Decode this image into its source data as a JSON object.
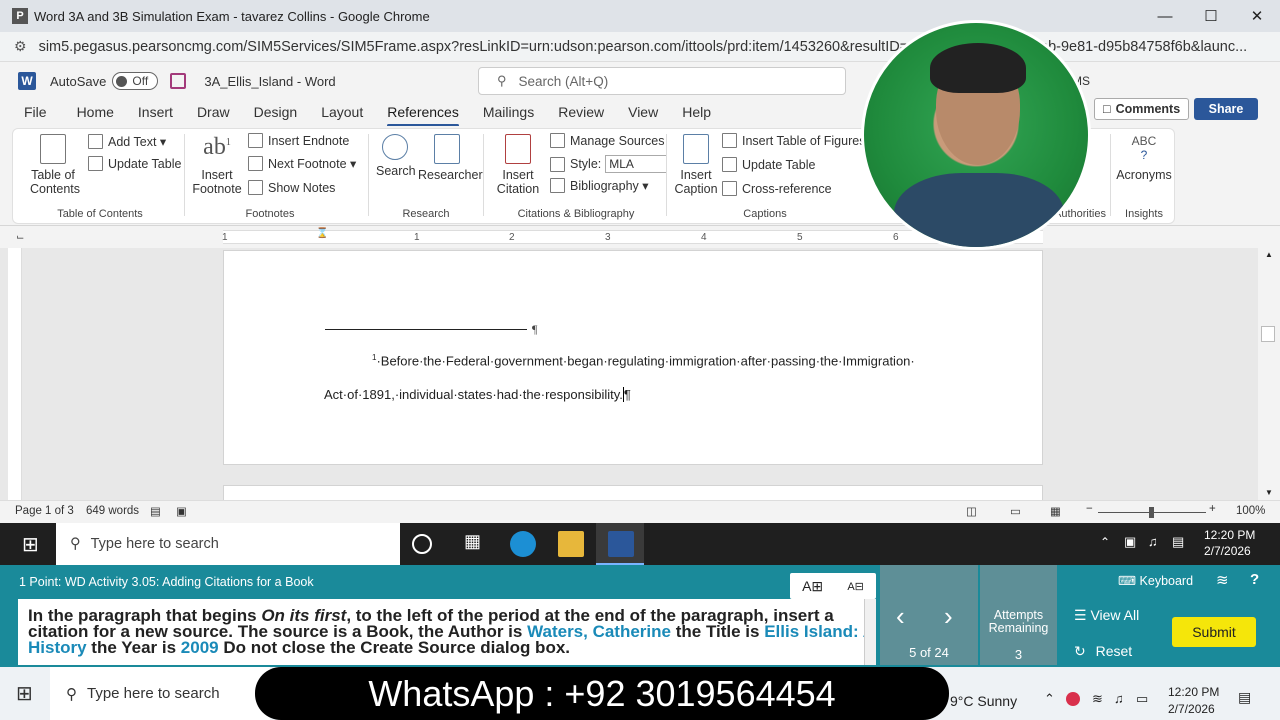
{
  "browser": {
    "favicon": "P",
    "title": "Word 3A and 3B Simulation Exam - tavarez Collins - Google Chrome",
    "url": "sim5.pegasus.pearsoncmg.com/SIM5Services/SIM5Frame.aspx?resLinkID=urn:udson:pearson.com/ittools/prd:item/1453260&resultID=&nor",
    "url_tail": "ab-9e81-d95b84758f6b&launc..."
  },
  "word": {
    "logo": "W",
    "autosave_label": "AutoSave",
    "autosave_state": "Off",
    "doc_title": "3A_Ellis_Island - Word",
    "search_placeholder": "Search (Alt+Q)",
    "user_initials": "MS",
    "comments_label": "Comments",
    "share_label": "Share",
    "tabs": [
      "File",
      "Home",
      "Insert",
      "Draw",
      "Design",
      "Layout",
      "References",
      "Mailings",
      "Review",
      "View",
      "Help"
    ],
    "active_tab": "References"
  },
  "ribbon": {
    "toc": {
      "btn": "Table of Contents",
      "add_text": "Add Text",
      "update_table": "Update Table",
      "group": "Table of Contents"
    },
    "footnotes": {
      "insert_footnote": "Insert Footnote",
      "insert_endnote": "Insert Endnote",
      "next_footnote": "Next Footnote",
      "show_notes": "Show Notes",
      "group": "Footnotes"
    },
    "research": {
      "search": "Search",
      "researcher": "Researcher",
      "group": "Research"
    },
    "citations": {
      "insert_citation": "Insert Citation",
      "manage_sources": "Manage Sources",
      "style_label": "Style:",
      "style_value": "MLA",
      "bibliography": "Bibliography",
      "group": "Citations & Bibliography"
    },
    "captions": {
      "insert_caption": "Insert Caption",
      "insert_tof": "Insert Table of Figures",
      "update_table": "Update Table",
      "cross_ref": "Cross-reference",
      "group": "Captions"
    },
    "authorities": {
      "group": "Authorities"
    },
    "insights": {
      "acronyms": "Acronyms",
      "group": "Insights",
      "abc": "ABC"
    }
  },
  "ruler": {
    "numbers": [
      "1",
      "1",
      "2",
      "3",
      "4",
      "5",
      "6"
    ]
  },
  "document": {
    "pilcrow": "¶",
    "footnote_num": "1",
    "footnote_line1": "·Before·the·Federal·government·began·regulating·immigration·after·passing·the·Immigration·",
    "footnote_line2": "Act·of·1891,·individual·states·had·the·responsibility.",
    "footnote_end": "¶"
  },
  "status": {
    "page": "Page 1 of 3",
    "words": "649 words",
    "zoom": "100%"
  },
  "taskbar": {
    "search": "Type here to search",
    "time": "12:20 PM",
    "date": "2/7/2026"
  },
  "task": {
    "header": "1 Point: WD Activity 3.05: Adding Citations for a Book",
    "instr_parts": [
      "In the paragraph that begins ",
      "On its first",
      ", to the left of the period at the end of the paragraph, insert a citation for a new source. The source is a Book, the Author is ",
      "Waters, Catherine",
      " the Title is ",
      "Ellis Island: A History",
      " the Year is ",
      "2009",
      " Do not close the Create Source dialog box."
    ],
    "font_up": "A",
    "font_down": "A",
    "keyboard": "Keyboard",
    "help": "?",
    "progress": "5 of 24",
    "attempts_label": "Attempts Remaining",
    "attempts": "3",
    "view_all": "View All",
    "reset": "Reset",
    "submit": "Submit"
  },
  "taskbar2": {
    "search": "Type here to search",
    "weather": "9°C  Sunny",
    "time": "12:20 PM",
    "date": "2/7/2026"
  },
  "overlay": {
    "whatsapp": "WhatsApp : +92 3019564454"
  }
}
